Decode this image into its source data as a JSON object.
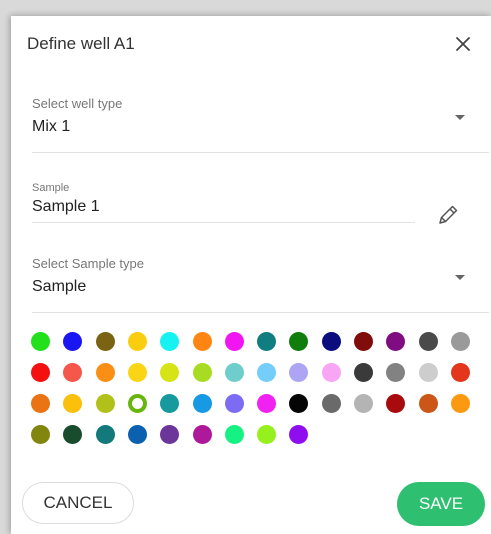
{
  "dialog": {
    "title": "Define well A1",
    "close_icon": "close-icon"
  },
  "well_type": {
    "label": "Select well type",
    "value": "Mix 1",
    "icon": "caret-down-icon"
  },
  "sample": {
    "label": "Sample",
    "value": "Sample 1",
    "icon": "pencil-icon"
  },
  "sample_type": {
    "label": "Select Sample type",
    "value": "Sample",
    "icon": "caret-down-icon"
  },
  "palette": {
    "selected_index": 31,
    "rows": [
      [
        "#22e01c",
        "#1a16f2",
        "#7a6414",
        "#fbcd11",
        "#16f1f2",
        "#fd8613",
        "#f116f1",
        "#107e80",
        "#107e0d",
        "#0b0c7e",
        "#800d0b",
        "#800c82",
        "#4a4a4a",
        "#9a9a9a"
      ],
      [
        "#f51010",
        "#f5584a",
        "#fb8f16",
        "#fad515",
        "#d6e314",
        "#a7dc22",
        "#6fcdcb",
        "#75cdfa",
        "#aba5f3",
        "#f8a5f4",
        "#3a3a3a",
        "#828282",
        "#cdcdcd",
        "#e3361c"
      ],
      [
        "#ea7414",
        "#fac00c",
        "#b2c11a",
        "#67b60f",
        "#169a9e",
        "#1799e3",
        "#7b6cf3",
        "#f022f1",
        "#050505",
        "#6a6a6a",
        "#b4b4b4",
        "#a80b0d",
        "#cc5518",
        "#fb9a10"
      ],
      [
        "#82860e",
        "#184c2d",
        "#14797a",
        "#0b60af",
        "#6b3599",
        "#ad199a",
        "#15f283",
        "#96f01e",
        "#8f0ef0"
      ]
    ]
  },
  "buttons": {
    "cancel": "CANCEL",
    "save": "SAVE"
  },
  "colors": {
    "accent": "#2fbf71",
    "divider": "#e2e2e2"
  }
}
